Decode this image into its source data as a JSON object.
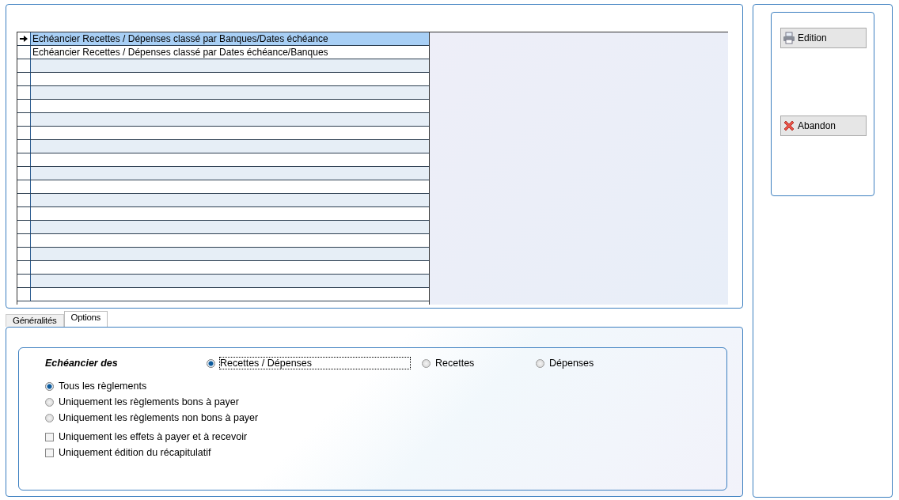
{
  "report_list": {
    "rows": [
      {
        "text": "Echéancier Recettes / Dépenses classé par Banques/Dates échéance",
        "selected": true
      },
      {
        "text": "Echéancier Recettes / Dépenses classé par Dates échéance/Banques",
        "selected": false
      }
    ]
  },
  "actions": [
    {
      "label": "Edition",
      "kind": "print"
    },
    {
      "label": "Abandon",
      "kind": "cancel"
    }
  ],
  "tabs": [
    {
      "label": "Généralités",
      "selected": false
    },
    {
      "label": "Options",
      "selected": true
    }
  ],
  "options": {
    "group_label": "Echéancier des",
    "type_choices": [
      {
        "label": "Recettes / Dépenses",
        "selected": true
      },
      {
        "label": "Recettes",
        "selected": false
      },
      {
        "label": "Dépenses",
        "selected": false
      }
    ],
    "settlement_choices": [
      {
        "label": "Tous les règlements",
        "selected": true
      },
      {
        "label": "Uniquement les règlements bons à payer",
        "selected": false
      },
      {
        "label": "Uniquement les règlements non bons à payer",
        "selected": false
      }
    ],
    "checkboxes": [
      {
        "label": "Uniquement les effets à payer et à recevoir",
        "checked": false
      },
      {
        "label": "Uniquement édition du récapitulatif",
        "checked": false
      }
    ]
  }
}
